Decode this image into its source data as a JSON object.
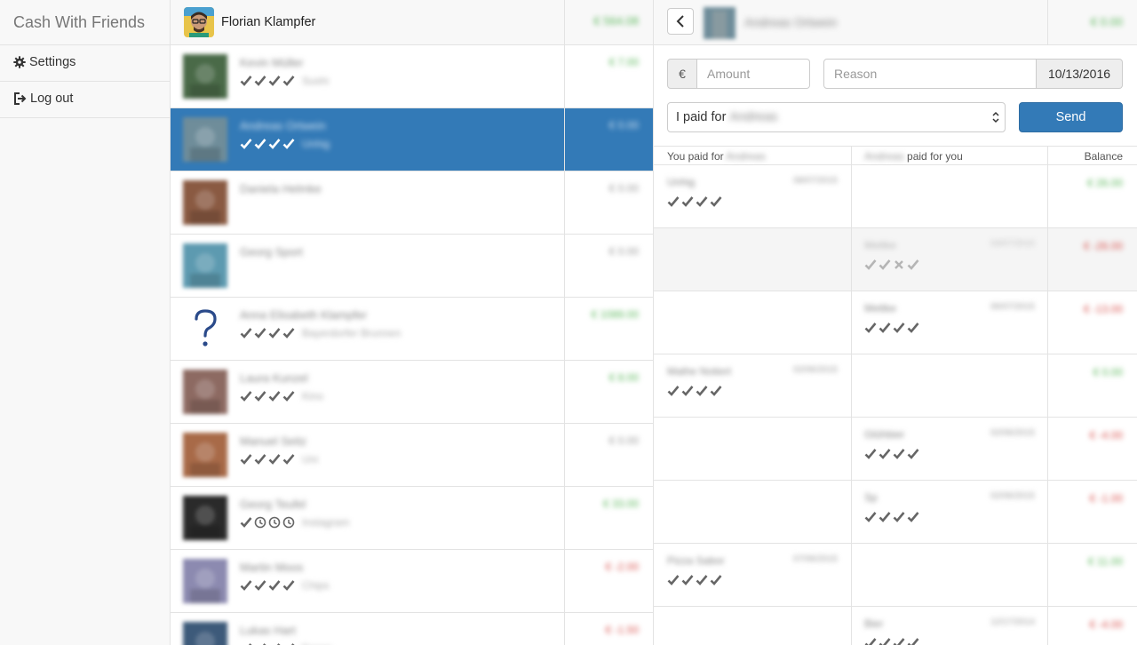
{
  "sidebar": {
    "brand": "Cash With Friends",
    "items": [
      {
        "label": "Settings",
        "icon": "gear-icon"
      },
      {
        "label": "Log out",
        "icon": "logout-icon"
      }
    ]
  },
  "me": {
    "name": "Florian Klampfer",
    "total": "€ 564.08"
  },
  "friends": [
    {
      "name": "Kevin Müller",
      "sub": "Sushi",
      "amount": "€ 7.00",
      "sign": "pos",
      "ticks": [
        "check",
        "check",
        "check",
        "check"
      ],
      "avatar": "#4a6a48"
    },
    {
      "name": "Andreas Ortwein",
      "sub": "Unhig",
      "amount": "€ 0.00",
      "sign": "zero",
      "ticks": [
        "check",
        "check",
        "check",
        "check"
      ],
      "avatar": "#6f8d9a",
      "active": true
    },
    {
      "name": "Daniela Helmke",
      "sub": "",
      "amount": "€ 0.00",
      "sign": "zero",
      "ticks": [],
      "avatar": "#8a5a42"
    },
    {
      "name": "Georg Sport",
      "sub": "",
      "amount": "€ 0.00",
      "sign": "zero",
      "ticks": [],
      "avatar": "#5d9ab0"
    },
    {
      "name": "Anna Elisabeth Klampfer",
      "sub": "Bayerdorfer Brunnen",
      "amount": "€ 1089.00",
      "sign": "pos",
      "ticks": [
        "check",
        "check",
        "check",
        "check"
      ],
      "avatar": "question"
    },
    {
      "name": "Laura Kunzel",
      "sub": "Kino",
      "amount": "€ 8.00",
      "sign": "pos",
      "ticks": [
        "check",
        "check",
        "check",
        "check"
      ],
      "avatar": "#8d6a62"
    },
    {
      "name": "Manuel Seitz",
      "sub": "Uni",
      "amount": "€ 0.00",
      "sign": "zero",
      "ticks": [
        "check",
        "check",
        "check",
        "check"
      ],
      "avatar": "#a86a48"
    },
    {
      "name": "Georg Teufel",
      "sub": "Instagram",
      "amount": "€ 33.00",
      "sign": "pos",
      "ticks": [
        "check",
        "clock",
        "clock",
        "clock"
      ],
      "avatar": "#2a2a2a"
    },
    {
      "name": "Martin Moos",
      "sub": "Chips",
      "amount": "€ -2.00",
      "sign": "neg",
      "ticks": [
        "check",
        "check",
        "check",
        "check"
      ],
      "avatar": "#8c8ab0"
    },
    {
      "name": "Lukas Hart",
      "sub": "Essen",
      "amount": "€ -1.50",
      "sign": "neg",
      "ticks": [
        "check",
        "check",
        "check",
        "check"
      ],
      "avatar": "#3d5a7a"
    }
  ],
  "detail": {
    "person": "Andreas Ortwein",
    "balance": "€ 0.00",
    "currency": "€",
    "amount_placeholder": "Amount",
    "reason_placeholder": "Reason",
    "date": "10/13/2016",
    "select_prefix": "I paid for",
    "select_name": "Andreas",
    "send_label": "Send",
    "col_you_paid": "You paid for",
    "col_they_paid": "paid for you",
    "col_name": "Andreas",
    "col_balance": "Balance",
    "rows": [
      {
        "side": "left",
        "reason": "Unhig",
        "date": "08/07/2015",
        "ticks": [
          "check",
          "check",
          "check",
          "check"
        ],
        "balance": "€ 26.00",
        "sign": "pos",
        "muted": false
      },
      {
        "side": "right",
        "reason": "Mettke",
        "date": "03/07/2015",
        "ticks": [
          "check",
          "check",
          "cross",
          "check"
        ],
        "balance": "€ -26.00",
        "sign": "neg",
        "muted": true
      },
      {
        "side": "right",
        "reason": "Mettke",
        "date": "06/07/2015",
        "ticks": [
          "check",
          "check",
          "check",
          "check"
        ],
        "balance": "€ -13.00",
        "sign": "neg",
        "muted": false
      },
      {
        "side": "left",
        "reason": "Mathe Notiert",
        "date": "02/06/2015",
        "ticks": [
          "check",
          "check",
          "check",
          "check"
        ],
        "balance": "€ 0.00",
        "sign": "pos",
        "muted": false
      },
      {
        "side": "right",
        "reason": "Glühbier",
        "date": "02/06/2015",
        "ticks": [
          "check",
          "check",
          "check",
          "check"
        ],
        "balance": "€ -4.00",
        "sign": "neg",
        "muted": false
      },
      {
        "side": "right",
        "reason": "Sp",
        "date": "02/06/2015",
        "ticks": [
          "check",
          "check",
          "check",
          "check"
        ],
        "balance": "€ -1.00",
        "sign": "neg",
        "muted": false
      },
      {
        "side": "left",
        "reason": "Pizza Sabor",
        "date": "07/06/2015",
        "ticks": [
          "check",
          "check",
          "check",
          "check"
        ],
        "balance": "€ 11.00",
        "sign": "pos",
        "muted": false
      },
      {
        "side": "right",
        "reason": "Bier",
        "date": "12/17/2014",
        "ticks": [
          "check",
          "check",
          "check",
          "check"
        ],
        "balance": "€ -4.00",
        "sign": "neg",
        "muted": false
      }
    ]
  },
  "colors": {
    "primary": "#337ab7",
    "positive": "#5cb85c",
    "negative": "#d9534f"
  }
}
